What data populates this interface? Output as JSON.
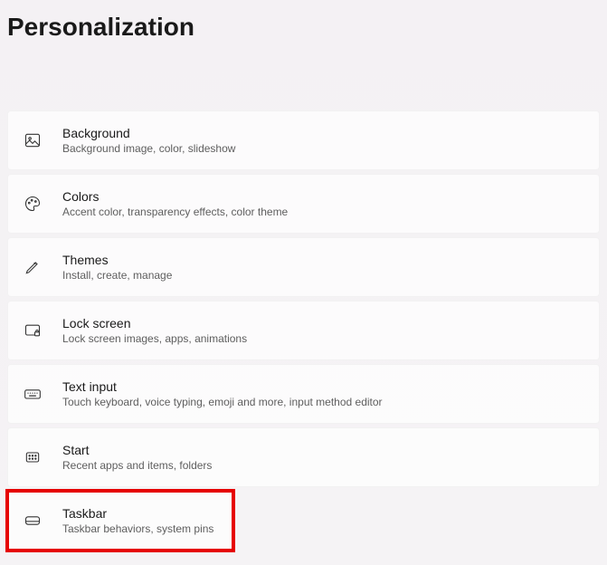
{
  "page": {
    "title": "Personalization"
  },
  "items": [
    {
      "icon": "image-icon",
      "title": "Background",
      "desc": "Background image, color, slideshow"
    },
    {
      "icon": "palette-icon",
      "title": "Colors",
      "desc": "Accent color, transparency effects, color theme"
    },
    {
      "icon": "pen-icon",
      "title": "Themes",
      "desc": "Install, create, manage"
    },
    {
      "icon": "lockscreen-icon",
      "title": "Lock screen",
      "desc": "Lock screen images, apps, animations"
    },
    {
      "icon": "keyboard-icon",
      "title": "Text input",
      "desc": "Touch keyboard, voice typing, emoji and more, input method editor"
    },
    {
      "icon": "start-icon",
      "title": "Start",
      "desc": "Recent apps and items, folders"
    },
    {
      "icon": "taskbar-icon",
      "title": "Taskbar",
      "desc": "Taskbar behaviors, system pins"
    }
  ]
}
